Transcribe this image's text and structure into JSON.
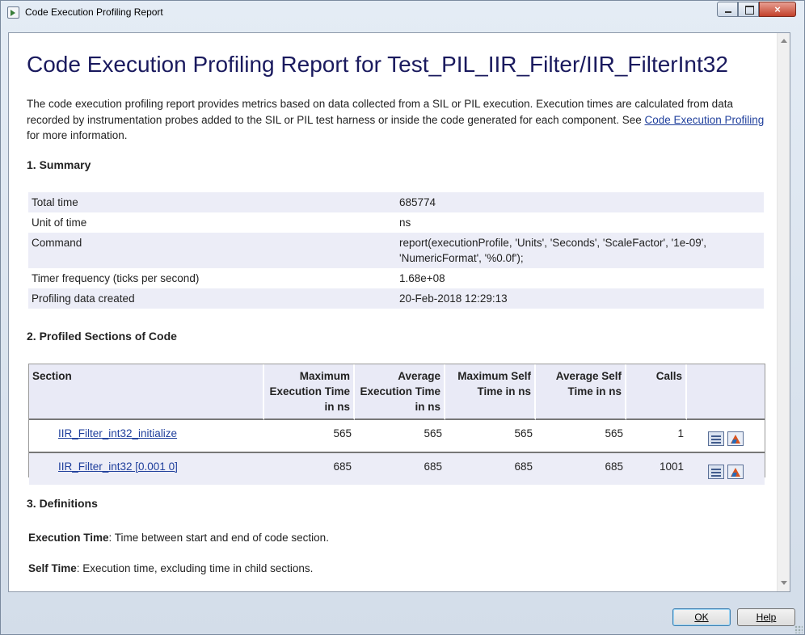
{
  "window": {
    "title": "Code Execution Profiling Report",
    "close_glyph": "×"
  },
  "report": {
    "heading": "Code Execution Profiling Report for Test_PIL_IIR_Filter/IIR_FilterInt32",
    "intro_text": "The code execution profiling report provides metrics based on data collected from a SIL or PIL execution. Execution times are calculated from data recorded by instrumentation probes added to the SIL or PIL test harness or inside the code generated for each component. See ",
    "intro_link": "Code Execution Profiling",
    "intro_tail": " for more information."
  },
  "summary": {
    "heading": "1. Summary",
    "rows": [
      {
        "label": "Total time",
        "value": "685774"
      },
      {
        "label": "Unit of time",
        "value": "ns"
      },
      {
        "label": "Command",
        "value": "report(executionProfile, 'Units', 'Seconds', 'ScaleFactor', '1e-09', 'NumericFormat', '%0.0f');"
      },
      {
        "label": "Timer frequency (ticks per second)",
        "value": "1.68e+08"
      },
      {
        "label": "Profiling data created",
        "value": "20-Feb-2018 12:29:13"
      }
    ]
  },
  "profiled": {
    "heading": "2. Profiled Sections of Code",
    "columns": [
      "Section",
      "Maximum Execution Time in ns",
      "Average Execution Time in ns",
      "Maximum Self Time in ns",
      "Average Self Time in ns",
      "Calls"
    ],
    "rows": [
      {
        "section": "IIR_Filter_int32_initialize",
        "max_exec": "565",
        "avg_exec": "565",
        "max_self": "565",
        "avg_self": "565",
        "calls": "1"
      },
      {
        "section": "IIR_Filter_int32 [0.001 0]",
        "max_exec": "685",
        "avg_exec": "685",
        "max_self": "685",
        "avg_self": "685",
        "calls": "1001"
      }
    ]
  },
  "definitions": {
    "heading": "3. Definitions",
    "exec_term": "Execution Time",
    "exec_def": ": Time between start and end of code section.",
    "self_term": "Self Time",
    "self_def": ": Execution time, excluding time in child sections."
  },
  "buttons": {
    "ok": "OK",
    "help": "Help"
  }
}
